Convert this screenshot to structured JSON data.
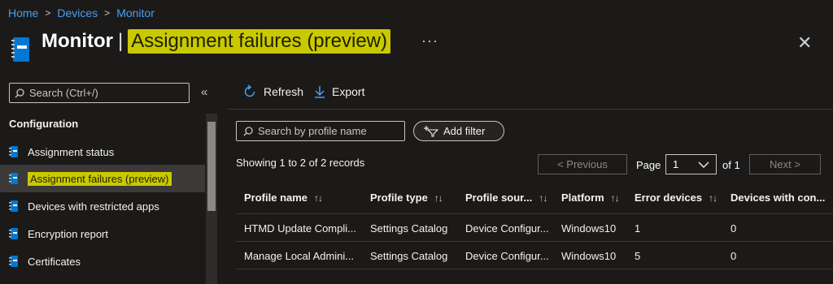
{
  "breadcrumb": [
    "Home",
    "Devices",
    "Monitor"
  ],
  "header": {
    "title": "Monitor",
    "separator": "|",
    "subtitle": "Assignment failures (preview)",
    "more": "···",
    "close": "✕"
  },
  "sidebar": {
    "search_placeholder": "Search (Ctrl+/)",
    "collapse": "«",
    "section": "Configuration",
    "items": [
      {
        "label": "Assignment status"
      },
      {
        "label": "Assignment failures (preview)"
      },
      {
        "label": "Devices with restricted apps"
      },
      {
        "label": "Encryption report"
      },
      {
        "label": "Certificates"
      }
    ]
  },
  "toolbar": {
    "refresh": "Refresh",
    "export": "Export"
  },
  "filters": {
    "search_placeholder": "Search by profile name",
    "add_filter": "Add filter"
  },
  "pager": {
    "showing": "Showing 1 to 2 of 2 records",
    "previous": "< Previous",
    "page_label": "Page",
    "page_value": "1",
    "of_label": "of 1",
    "next": "Next >"
  },
  "table": {
    "columns": [
      "Profile name",
      "Profile type",
      "Profile sour...",
      "Platform",
      "Error devices",
      "Devices with con..."
    ],
    "rows": [
      [
        "HTMD Update Compli...",
        "Settings Catalog",
        "Device Configur...",
        "Windows10",
        "1",
        "0"
      ],
      [
        "Manage Local Admini...",
        "Settings Catalog",
        "Device Configur...",
        "Windows10",
        "5",
        "0"
      ]
    ]
  },
  "colors": {
    "link": "#479ef5",
    "highlight": "#c9c900",
    "background": "#1b1a19"
  }
}
